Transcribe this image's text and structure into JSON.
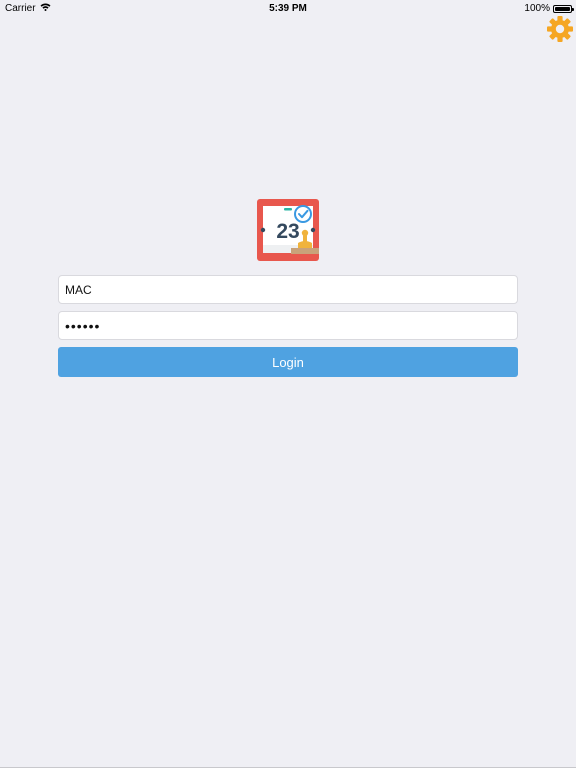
{
  "status_bar": {
    "carrier": "Carrier",
    "time": "5:39 PM",
    "battery": "100%",
    "battery_level": 1.0
  },
  "header": {
    "settings_icon": "gear-icon",
    "accent_color": "#f5a623"
  },
  "logo": {
    "icon": "calendar-stamp-logo",
    "date_number": "23",
    "frame_color": "#e8574d"
  },
  "login_form": {
    "username_value": "MAC",
    "password_value": "••••••",
    "login_label": "Login",
    "button_color": "#4fa2e1"
  }
}
